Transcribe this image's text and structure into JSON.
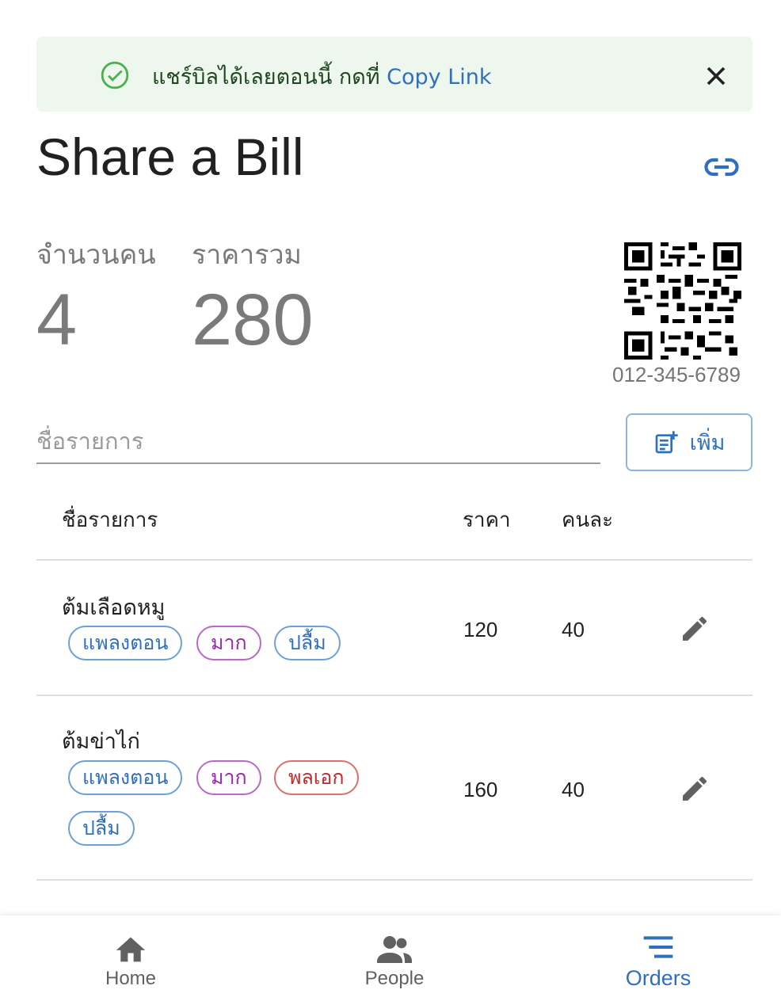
{
  "alert": {
    "message": "แชร์บิลได้เลยตอนนี้ กดที่ ",
    "link_text": "Copy Link"
  },
  "header": {
    "title": "Share a Bill"
  },
  "stats": {
    "people_label": "จำนวนคน",
    "people_value": "4",
    "total_label": "ราคารวม",
    "total_value": "280"
  },
  "payment": {
    "phone": "012-345-6789"
  },
  "form": {
    "item_placeholder": "ชื่อรายการ",
    "add_label": "เพิ่ม"
  },
  "table": {
    "headers": {
      "name": "ชื่อรายการ",
      "price": "ราคา",
      "per_person": "คนละ"
    },
    "rows": [
      {
        "name": "ต้มเลือดหมู",
        "price": "120",
        "per_person": "40",
        "people": [
          {
            "name": "แพลงตอน",
            "color": "#2f6fc0"
          },
          {
            "name": "มาก",
            "color": "#9c27b0"
          },
          {
            "name": "ปลื้ม",
            "color": "#2f6fc0"
          }
        ]
      },
      {
        "name": "ต้มข่าไก่",
        "price": "160",
        "per_person": "40",
        "people": [
          {
            "name": "แพลงตอน",
            "color": "#2f6fc0"
          },
          {
            "name": "มาก",
            "color": "#9c27b0"
          },
          {
            "name": "พลเอก",
            "color": "#c62828"
          },
          {
            "name": "ปลื้ม",
            "color": "#2f6fc0"
          }
        ]
      }
    ]
  },
  "nav": {
    "items": [
      {
        "label": "Home",
        "icon": "home-icon"
      },
      {
        "label": "People",
        "icon": "people-icon"
      },
      {
        "label": "Orders",
        "icon": "orders-icon",
        "active": true
      }
    ]
  },
  "colors": {
    "accent": "#2f6fc0",
    "success_bg": "#edf7ed",
    "success": "#4caf50"
  }
}
